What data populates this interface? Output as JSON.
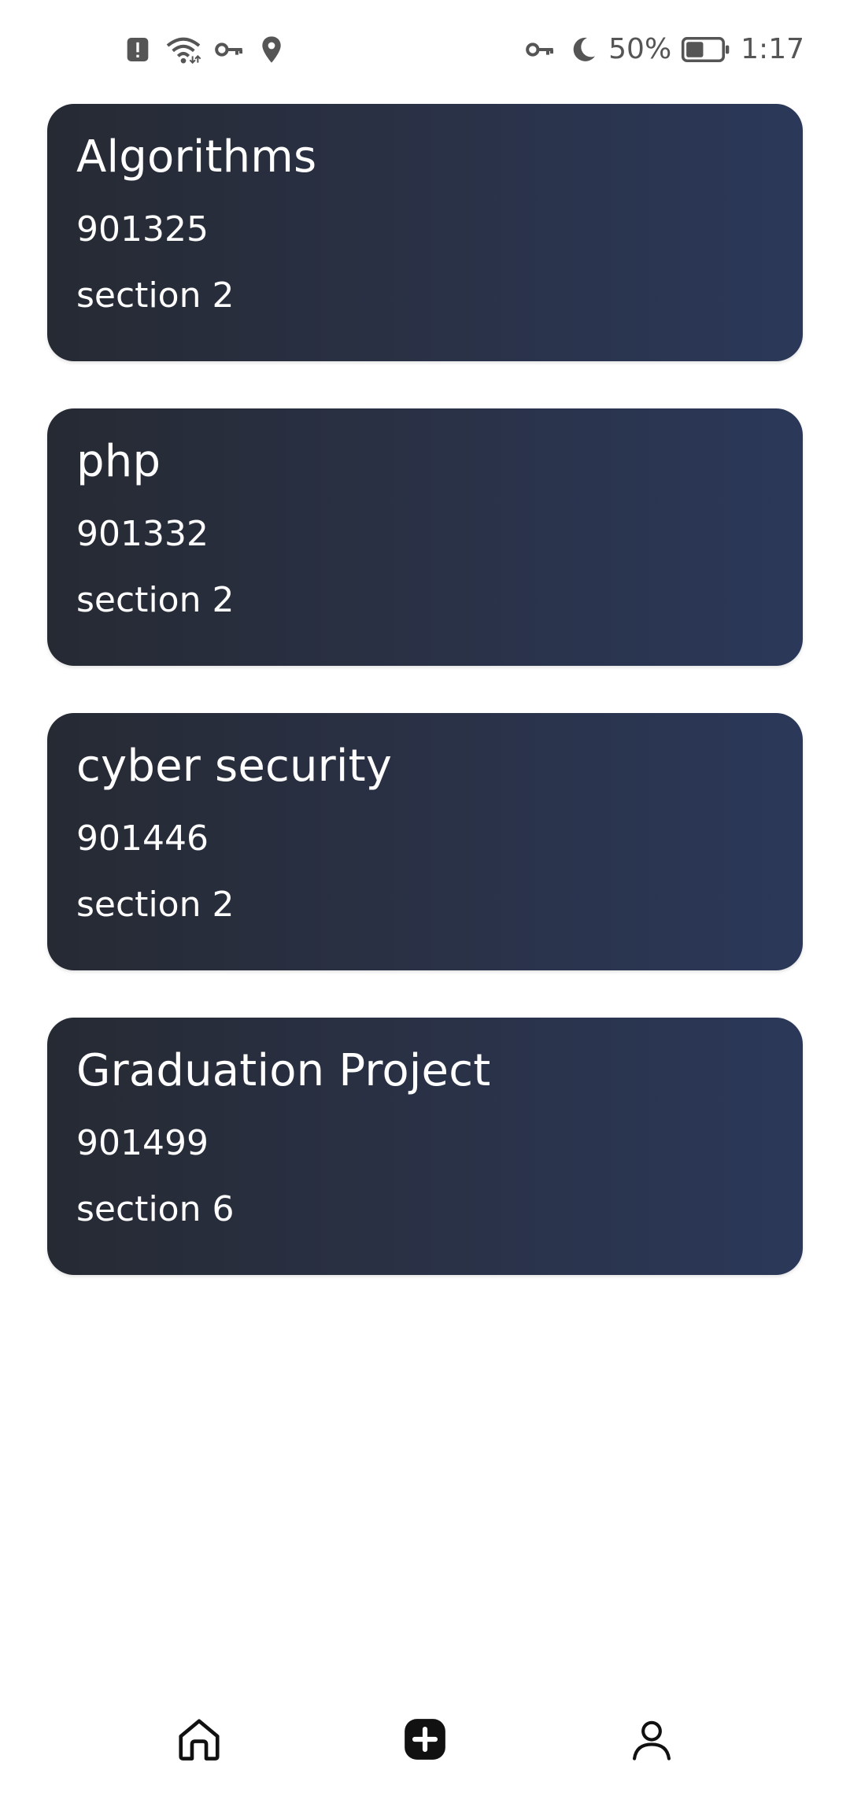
{
  "status_bar": {
    "left_icons": [
      "alert-icon",
      "wifi-icon",
      "vpn-key-icon",
      "location-icon"
    ],
    "right_icons": [
      "vpn-key-icon",
      "moon-icon",
      "battery-icon"
    ],
    "battery": "50%",
    "time": "1:17"
  },
  "courses": [
    {
      "title": "Algorithms",
      "code": "901325",
      "section": "section 2"
    },
    {
      "title": "php",
      "code": "901332",
      "section": "section 2"
    },
    {
      "title": "cyber security",
      "code": "901446",
      "section": "section 2"
    },
    {
      "title": "Graduation Project",
      "code": "901499",
      "section": "section 6"
    }
  ],
  "bottom_nav": {
    "items": [
      "home-icon",
      "add-icon",
      "profile-icon"
    ]
  },
  "colors": {
    "card_start": "#262a33",
    "card_end": "#2b3859",
    "text_on_card": "#ffffff",
    "icon": "#111111"
  }
}
